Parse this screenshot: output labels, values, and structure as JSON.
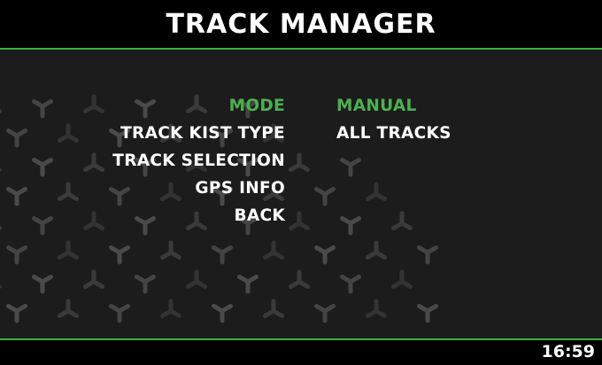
{
  "header": {
    "title": "TRACK MANAGER"
  },
  "menu": {
    "items": [
      {
        "label": "MODE",
        "value": "MANUAL",
        "selected": true
      },
      {
        "label": "TRACK KIST TYPE",
        "value": "ALL TRACKS",
        "selected": false
      },
      {
        "label": "TRACK SELECTION",
        "value": "",
        "selected": false
      },
      {
        "label": "GPS INFO",
        "value": "",
        "selected": false
      },
      {
        "label": "BACK",
        "value": "",
        "selected": false
      }
    ]
  },
  "footer": {
    "clock": "16:59"
  },
  "colors": {
    "accent": "#4cb050",
    "background": "#1c1c1c",
    "bar": "#000000",
    "text": "#ffffff"
  }
}
